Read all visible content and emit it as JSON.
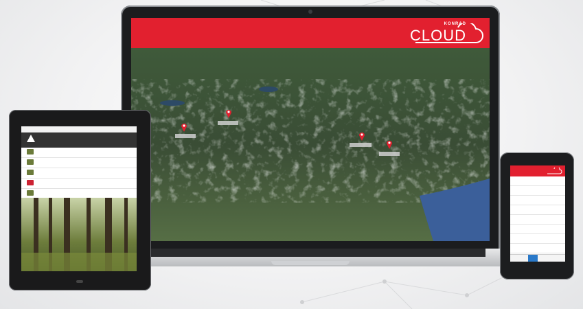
{
  "brand": {
    "company": "KONRAD",
    "product": "CLOUD",
    "accent_color": "#e2202f"
  },
  "map": {
    "pin_icon": "map-pin-icon",
    "pin_color": "#e2202f"
  },
  "tablet": {
    "topbar_icon": "status-bar",
    "forest_image": "forest-photo"
  },
  "phone": {
    "header_icon": "cloud-logo-icon",
    "active_tab_color": "#2a79c9"
  }
}
